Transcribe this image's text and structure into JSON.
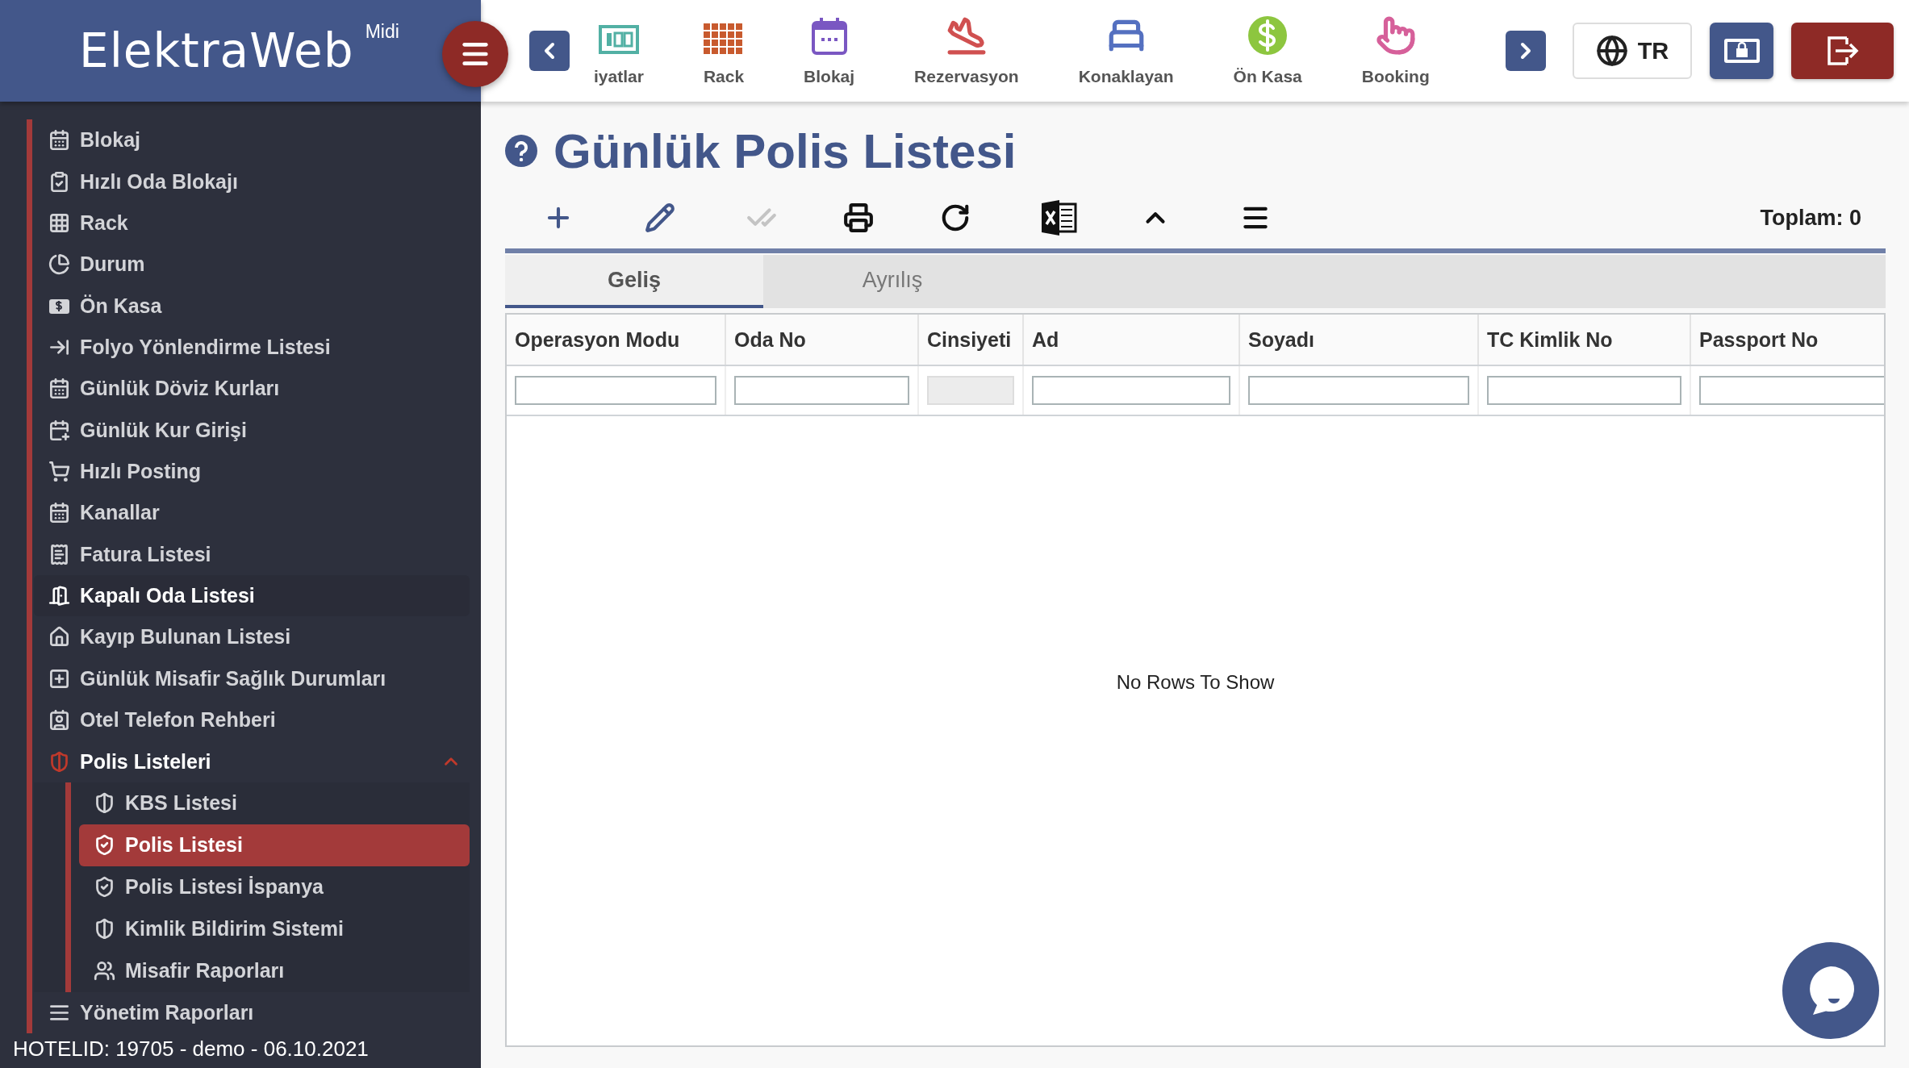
{
  "brand": {
    "name": "ElektraWeb",
    "edition": "Midi"
  },
  "nav_items": [
    {
      "label": "iyatlar",
      "kind": "price"
    },
    {
      "label": "Rack",
      "kind": "rack"
    },
    {
      "label": "Blokaj",
      "kind": "calendar"
    },
    {
      "label": "Rezervasyon",
      "kind": "landing"
    },
    {
      "label": "Konaklayan",
      "kind": "bed"
    },
    {
      "label": "Ön Kasa",
      "kind": "cash"
    },
    {
      "label": "Booking",
      "kind": "touch"
    }
  ],
  "language": "TR",
  "sidebar": {
    "items": [
      {
        "label": "Blokaj",
        "kind": "calendar",
        "highlighted": false
      },
      {
        "label": "Hızlı Oda Blokajı",
        "kind": "clipboard",
        "highlighted": false
      },
      {
        "label": "Rack",
        "kind": "grid",
        "highlighted": false
      },
      {
        "label": "Durum",
        "kind": "pie",
        "highlighted": false
      },
      {
        "label": "Ön Kasa",
        "kind": "cash",
        "highlighted": false
      },
      {
        "label": "Folyo Yönlendirme Listesi",
        "kind": "redirect",
        "highlighted": false
      },
      {
        "label": "Günlük Döviz Kurları",
        "kind": "calendar",
        "highlighted": false
      },
      {
        "label": "Günlük Kur Girişi",
        "kind": "calendar-plus",
        "highlighted": false
      },
      {
        "label": "Hızlı Posting",
        "kind": "cart",
        "highlighted": false
      },
      {
        "label": "Kanallar",
        "kind": "calendar",
        "highlighted": false
      },
      {
        "label": "Fatura Listesi",
        "kind": "receipt",
        "highlighted": false
      },
      {
        "label": "Kapalı Oda Listesi",
        "kind": "door",
        "highlighted": true
      },
      {
        "label": "Kayıp Bulunan Listesi",
        "kind": "house-search",
        "highlighted": false
      },
      {
        "label": "Günlük Misafir Sağlık Durumları",
        "kind": "plus-square",
        "highlighted": false
      },
      {
        "label": "Otel Telefon Rehberi",
        "kind": "contact",
        "highlighted": false
      },
      {
        "label": "Polis Listeleri",
        "kind": "shield-half",
        "highlighted": true,
        "expanded": true,
        "children": [
          {
            "label": "KBS Listesi",
            "kind": "shield-half",
            "selected": false
          },
          {
            "label": "Polis Listesi",
            "kind": "shield-check",
            "selected": true
          },
          {
            "label": "Polis Listesi İspanya",
            "kind": "shield-check",
            "selected": false
          },
          {
            "label": "Kimlik Bildirim Sistemi",
            "kind": "shield-half",
            "selected": false
          },
          {
            "label": "Misafir Raporları",
            "kind": "users",
            "selected": false
          }
        ]
      },
      {
        "label": "Yönetim Raporları",
        "kind": "lines",
        "highlighted": false
      }
    ],
    "footer": "HOTELID: 19705 - demo - 06.10.2021"
  },
  "page": {
    "title": "Günlük Polis Listesi",
    "toolbar": [
      {
        "kind": "add",
        "disabled": false
      },
      {
        "kind": "edit",
        "disabled": false
      },
      {
        "kind": "approve",
        "disabled": true
      },
      {
        "kind": "print",
        "disabled": false
      },
      {
        "kind": "refresh",
        "disabled": false
      },
      {
        "kind": "excel",
        "disabled": false
      },
      {
        "kind": "collapse",
        "disabled": false
      },
      {
        "kind": "menu",
        "disabled": false
      }
    ],
    "total": "Toplam: 0",
    "tabs": [
      {
        "label": "Geliş",
        "selected": true
      },
      {
        "label": "Ayrılış",
        "selected": false
      }
    ],
    "table": {
      "columns": [
        {
          "label": "Operasyon Modu",
          "filter_disabled": false
        },
        {
          "label": "Oda No",
          "filter_disabled": false
        },
        {
          "label": "Cinsiyeti",
          "filter_disabled": true
        },
        {
          "label": "Ad",
          "filter_disabled": false
        },
        {
          "label": "Soyadı",
          "filter_disabled": false
        },
        {
          "label": "TC Kimlik No",
          "filter_disabled": false
        },
        {
          "label": "Passport No",
          "filter_disabled": false
        }
      ],
      "empty_message": "No Rows To Show"
    }
  }
}
